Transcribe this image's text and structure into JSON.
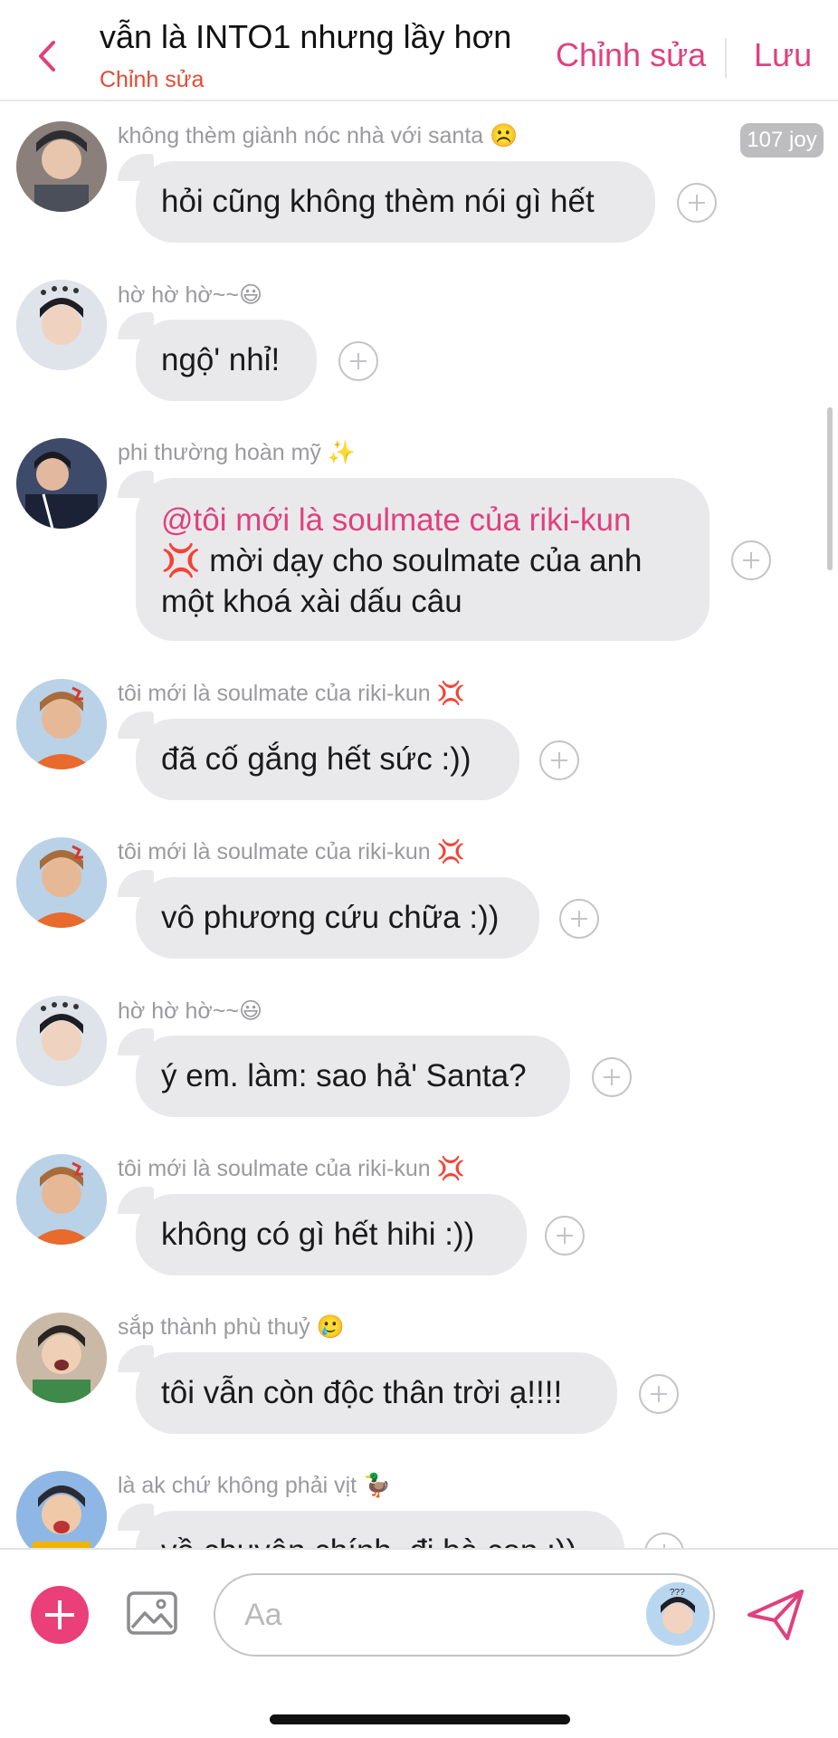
{
  "header": {
    "title": "vẫn là INTO1 nhưng lầy hơn",
    "subtitle": "Chỉnh sửa",
    "edit_label": "Chỉnh sửa",
    "save_label": "Lưu",
    "accent_color": "#e0407e"
  },
  "badge": {
    "count_label": "107 joy"
  },
  "messages": [
    {
      "sender": "không thèm giành nóc nhà với santa ☹️",
      "lines": [
        "hỏi cũng không thèm nói gì hết"
      ]
    },
    {
      "sender": "hờ hờ hờ~~😃",
      "lines": [
        "ngộ' nhỉ!"
      ]
    },
    {
      "sender": "phi thường hoàn mỹ ✨",
      "mention": "@tôi mới là soulmate của riki-kun",
      "lines": [
        "💢 mời dạy cho soulmate của anh",
        "một khoá xài dấu câu"
      ]
    },
    {
      "sender": "tôi mới là soulmate của riki-kun 💢",
      "lines": [
        "đã cố gắng hết sức :))"
      ]
    },
    {
      "sender": "tôi mới là soulmate của riki-kun 💢",
      "lines": [
        "vô phương cứu chữa :))"
      ]
    },
    {
      "sender": "hờ hờ hờ~~😃",
      "lines": [
        "ý em. làm: sao hả' Santa?"
      ]
    },
    {
      "sender": "tôi mới là soulmate của riki-kun 💢",
      "lines": [
        "không có gì hết hihi :))"
      ]
    },
    {
      "sender": "sắp thành phù thuỷ 🥲",
      "lines": [
        "tôi vẫn còn độc thân trời ạ!!!!"
      ]
    },
    {
      "sender": "là ak chứ không phải vịt 🦆",
      "lines": [
        "về chuyện chính, đi bà con :))"
      ]
    }
  ],
  "composer": {
    "placeholder": "Aa"
  },
  "icons": {
    "back": "chevron-left-icon",
    "add": "plus-icon",
    "image": "image-icon",
    "send": "send-icon",
    "react": "add-reaction-icon"
  }
}
